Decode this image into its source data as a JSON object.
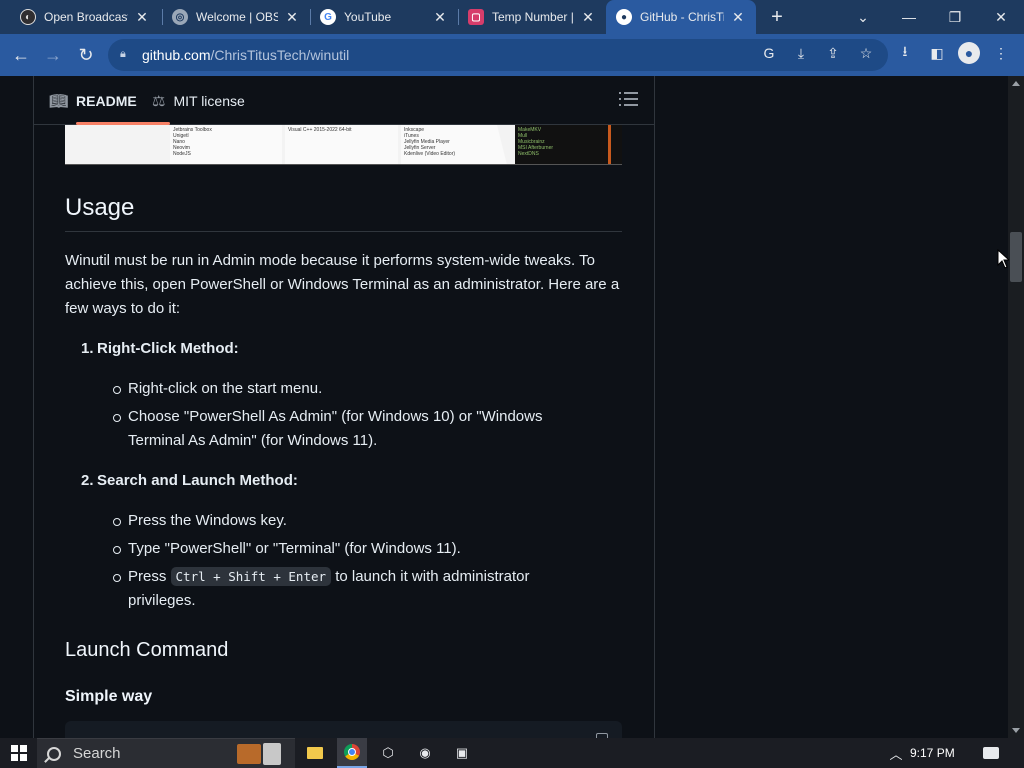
{
  "browser": {
    "tabs": [
      {
        "title": "Open Broadcaster",
        "icon": "obs-icon"
      },
      {
        "title": "Welcome | OBS",
        "icon": "globe-icon"
      },
      {
        "title": "YouTube",
        "icon": "google-icon"
      },
      {
        "title": "Temp Number |",
        "icon": "temp-number-icon"
      },
      {
        "title": "GitHub - ChrisTi",
        "icon": "github-icon",
        "active": true
      }
    ],
    "url_host": "github.com",
    "url_path": "/ChrisTitusTech/winutil"
  },
  "readme": {
    "tab_readme": "README",
    "tab_license": "MIT license"
  },
  "content": {
    "usage_heading": "Usage",
    "intro": "Winutil must be run in Admin mode because it performs system-wide tweaks. To achieve this, open PowerShell or Windows Terminal as an administrator. Here are a few ways to do it:",
    "method1_num": "1.",
    "method1_title": "Right-Click Method:",
    "method1_b1": "Right-click on the start menu.",
    "method1_b2": "Choose \"PowerShell As Admin\" (for Windows 10) or \"Windows Terminal As Admin\" (for Windows 11).",
    "method2_num": "2.",
    "method2_title": "Search and Launch Method:",
    "method2_b1": "Press the Windows key.",
    "method2_b2": "Type \"PowerShell\" or \"Terminal\" (for Windows 11).",
    "method2_b3_pre": "Press ",
    "method2_b3_kbd": "Ctrl + Shift + Enter",
    "method2_b3_post": " to launch it with administrator privileges.",
    "launch_heading": "Launch Command",
    "simple_heading": "Simple way"
  },
  "embedded_screenshot": {
    "col1": [
      "Jetbrains Toolbox",
      "Unigetl",
      "Nano",
      "Neovim",
      "NodeJS"
    ],
    "col2": [
      "Visual C++ 2015-2022 64-bit"
    ],
    "col3": [
      "Inkscape",
      "iTunes",
      "Jellyfin Media Player",
      "Jellyfin Server",
      "Kdenlive (Video Editor)"
    ],
    "col4": [
      "MakeMKV",
      "Mull",
      "Musicbrainz",
      "MSI Afterburner",
      "NextDNS"
    ]
  },
  "taskbar": {
    "search_label": "Search",
    "time": "9:17 PM"
  }
}
